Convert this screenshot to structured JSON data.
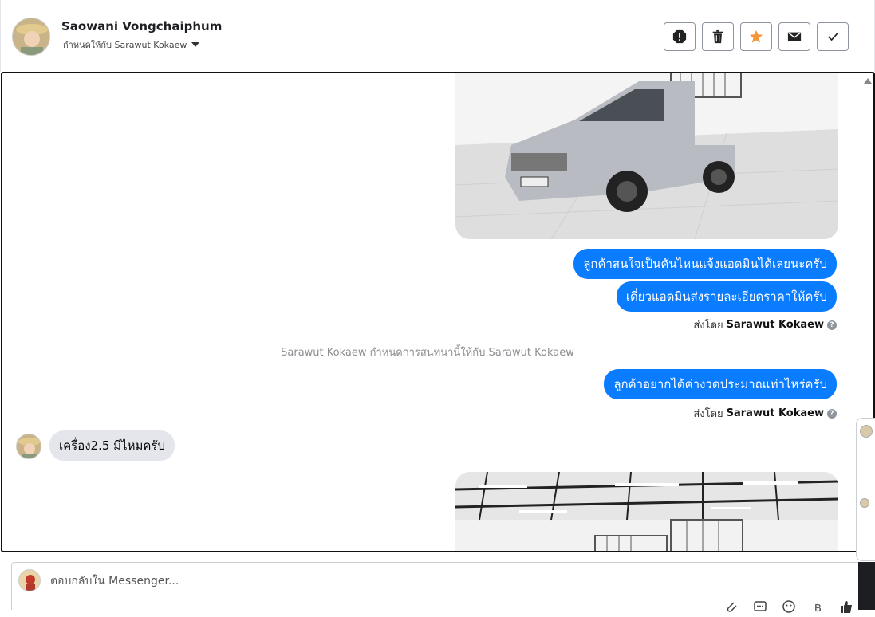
{
  "header": {
    "contact_name": "Saowani Vongchaiphum",
    "assigned_to": "กำหนดให้กับ Sarawut Kokaew",
    "actions": [
      {
        "name": "report-button",
        "icon": "alert-icon"
      },
      {
        "name": "delete-button",
        "icon": "trash-icon"
      },
      {
        "name": "star-button",
        "icon": "star-icon"
      },
      {
        "name": "mark-unread-button",
        "icon": "envelope-icon"
      },
      {
        "name": "done-button",
        "icon": "check-icon"
      }
    ]
  },
  "messages": {
    "out1": "ลูกค้าสนใจเป็นคันไหนแจ้งแอดมินได้เลยนะครับ",
    "out2": "เดี๋ยวแอดมินส่งรายละเอียดราคาให้ครับ",
    "sent_by_prefix": "ส่งโดย",
    "sent_by_name": "Sarawut Kokaew",
    "system_note": "Sarawut Kokaew กำหนดการสนทนานี้ให้กับ Sarawut Kokaew",
    "out3": "ลูกค้าอยากได้ค่างวดประมาณเท่าไหร่ครับ",
    "sent_by_prefix_2": "ส่งโดย",
    "sent_by_name_2": "Sarawut Kokaew",
    "in1": "เครื่อง2.5 มีไหมครับ"
  },
  "reply": {
    "placeholder": "ตอบกลับใน Messenger..."
  },
  "colors": {
    "outgoing_bubble": "#0a7cff",
    "incoming_bubble": "#e4e6eb",
    "star_accent": "#f5943a"
  }
}
